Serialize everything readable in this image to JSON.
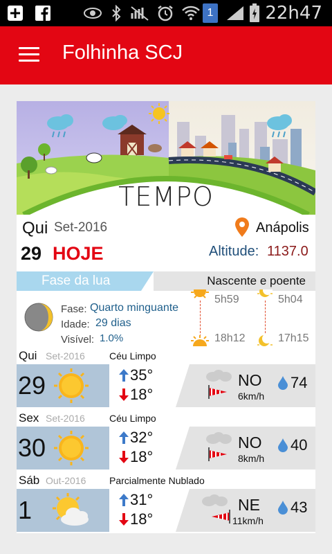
{
  "status_bar": {
    "icons": [
      "add-icon",
      "facebook-icon",
      "eye-icon",
      "bluetooth-icon",
      "mute-icon",
      "alarm-icon",
      "wifi-icon",
      "sim-icon",
      "signal-icon",
      "battery-icon"
    ],
    "sim_badge": "1",
    "time": "22h47"
  },
  "app_bar": {
    "title": "Folhinha SCJ",
    "menu_icon": "menu-icon",
    "color": "#e30613"
  },
  "hero": {
    "title": "TEMPO"
  },
  "today": {
    "day_name": "Qui",
    "month_year": "Set-2016",
    "day_number": "29",
    "today_label": "HOJE",
    "city": "Anápolis",
    "altitude_label": "Altitude:",
    "altitude_value": "1137.0"
  },
  "moon": {
    "header": "Fase da lua",
    "phase_label": "Fase:",
    "phase_value": "Quarto minguante",
    "age_label": "Idade:",
    "age_value": "29 dias",
    "visible_label": "Visível:",
    "visible_value": "1.0%"
  },
  "rise_set": {
    "header": "Nascente e poente",
    "sun_rise": "5h59",
    "sun_set": "18h12",
    "moon_rise": "5h04",
    "moon_set": "17h15"
  },
  "forecast": [
    {
      "day": "Qui",
      "month": "Set-2016",
      "condition": "Céu Limpo",
      "date": "29",
      "icon": "sun-icon",
      "max": "35°",
      "min": "18°",
      "wind_dir": "NO",
      "wind_speed": "6km/h",
      "humidity": "74"
    },
    {
      "day": "Sex",
      "month": "Set-2016",
      "condition": "Céu Limpo",
      "date": "30",
      "icon": "sun-icon",
      "max": "32°",
      "min": "18°",
      "wind_dir": "NO",
      "wind_speed": "8km/h",
      "humidity": "40"
    },
    {
      "day": "Sáb",
      "month": "Out-2016",
      "condition": "Parcialmente Nublado",
      "date": "1",
      "icon": "partly-cloudy-icon",
      "max": "31°",
      "min": "18°",
      "wind_dir": "NE",
      "wind_speed": "11km/h",
      "humidity": "43"
    }
  ]
}
